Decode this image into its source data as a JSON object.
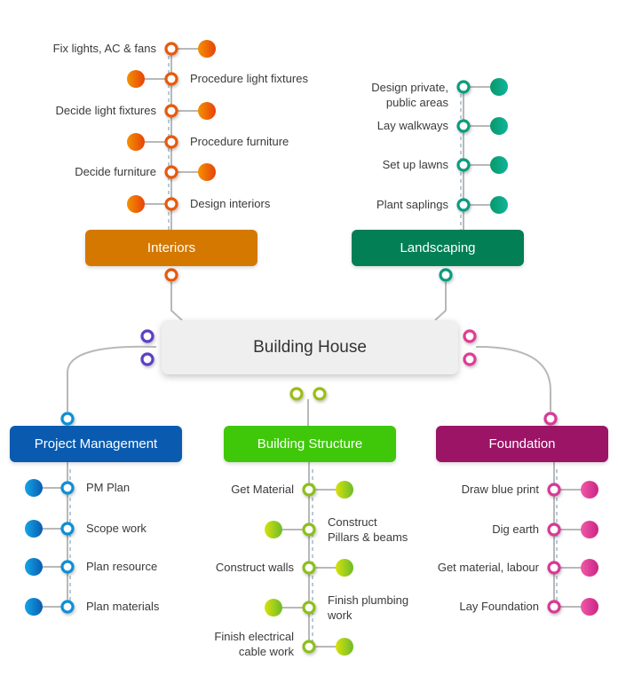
{
  "center": {
    "label": "Building House",
    "connector_color": "#5b3fc4"
  },
  "branches": [
    {
      "id": "interiors",
      "label": "Interiors",
      "color": "#d47800",
      "node_color": "#e65a0a",
      "dot_from": "#f39200",
      "dot_to": "#e8420a",
      "items": [
        {
          "label": "Fix lights, AC & fans",
          "side": "left"
        },
        {
          "label": "Procedure light fixtures",
          "side": "right"
        },
        {
          "label": "Decide light fixtures",
          "side": "left"
        },
        {
          "label": "Procedure furniture",
          "side": "right"
        },
        {
          "label": "Decide furniture",
          "side": "left"
        },
        {
          "label": "Design interiors",
          "side": "right"
        }
      ]
    },
    {
      "id": "landscaping",
      "label": "Landscaping",
      "color": "#037f55",
      "node_color": "#0d9c80",
      "dot_from": "#07986a",
      "dot_to": "#12b49b",
      "items": [
        {
          "label": "Design private,\npublic areas",
          "side": "left"
        },
        {
          "label": "Lay walkways",
          "side": "left"
        },
        {
          "label": "Set up lawns",
          "side": "left"
        },
        {
          "label": "Plant saplings",
          "side": "left"
        }
      ]
    },
    {
      "id": "project-management",
      "label": "Project Management",
      "color": "#0a5bb0",
      "node_color": "#0a8fd6",
      "dot_from": "#13a6e6",
      "dot_to": "#0a5bb0",
      "items": [
        {
          "label": "PM Plan",
          "side": "right"
        },
        {
          "label": "Scope work",
          "side": "right"
        },
        {
          "label": "Plan resource",
          "side": "right"
        },
        {
          "label": "Plan materials",
          "side": "right"
        }
      ]
    },
    {
      "id": "building-structure",
      "label": "Building Structure",
      "color": "#3fc80a",
      "node_color": "#8cbf1a",
      "dot_from": "#d8e20a",
      "dot_to": "#6dbb2c",
      "items": [
        {
          "label": "Get Material",
          "side": "left"
        },
        {
          "label": "Construct\nPillars & beams",
          "side": "right"
        },
        {
          "label": "Construct walls",
          "side": "left"
        },
        {
          "label": "Finish plumbing\nwork",
          "side": "right"
        },
        {
          "label": "Finish electrical\ncable work",
          "side": "left"
        }
      ]
    },
    {
      "id": "foundation",
      "label": "Foundation",
      "color": "#9b1466",
      "node_color": "#d63a95",
      "dot_from": "#f25aa8",
      "dot_to": "#c92485",
      "items": [
        {
          "label": "Draw blue print",
          "side": "left"
        },
        {
          "label": "Dig earth",
          "side": "left"
        },
        {
          "label": "Get material, labour",
          "side": "left"
        },
        {
          "label": "Lay Foundation",
          "side": "left"
        }
      ]
    }
  ]
}
